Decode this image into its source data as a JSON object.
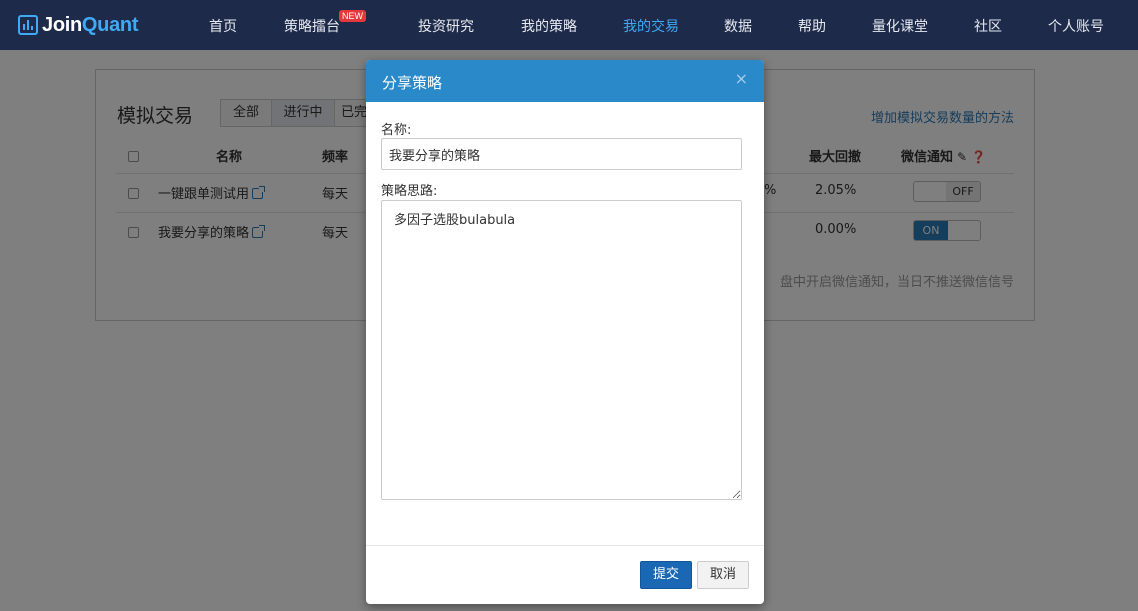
{
  "brand": {
    "name_part1": "Join",
    "name_part2": "Quant"
  },
  "nav": {
    "items": [
      "首页",
      "策略擂台",
      "投资研究",
      "我的策略",
      "我的交易",
      "数据",
      "帮助",
      "量化课堂",
      "社区",
      "个人账号"
    ],
    "active_index": 4,
    "new_badge": "NEW",
    "accent_color": "#3fa9f5"
  },
  "page": {
    "title": "模拟交易",
    "segments": [
      "全部",
      "进行中",
      "已完"
    ],
    "active_segment": 1,
    "link_more": "增加模拟交易数量的方法",
    "headers": {
      "name": "名称",
      "frequency": "频率",
      "max_drawdown": "最大回撤",
      "wechat": "微信通知"
    },
    "rows": [
      {
        "name": "一键跟单测试用",
        "frequency": "每天",
        "partial": "%",
        "max_drawdown": "2.05%",
        "wechat": "OFF"
      },
      {
        "name": "我要分享的策略",
        "frequency": "每天",
        "partial": "",
        "max_drawdown": "0.00%",
        "wechat": "ON"
      }
    ],
    "note": "盘中开启微信通知，当日不推送微信信号"
  },
  "modal": {
    "title": "分享策略",
    "close": "×",
    "name_label": "名称:",
    "name_value": "我要分享的策略",
    "idea_label": "策略思路:",
    "idea_value": "多因子选股bulabula",
    "submit": "提交",
    "cancel": "取消"
  },
  "colors": {
    "nav_bg": "#1e2a4a",
    "modal_header": "#2a89c9",
    "submit_button": "#1a68b4",
    "link": "#2a7ab8"
  }
}
